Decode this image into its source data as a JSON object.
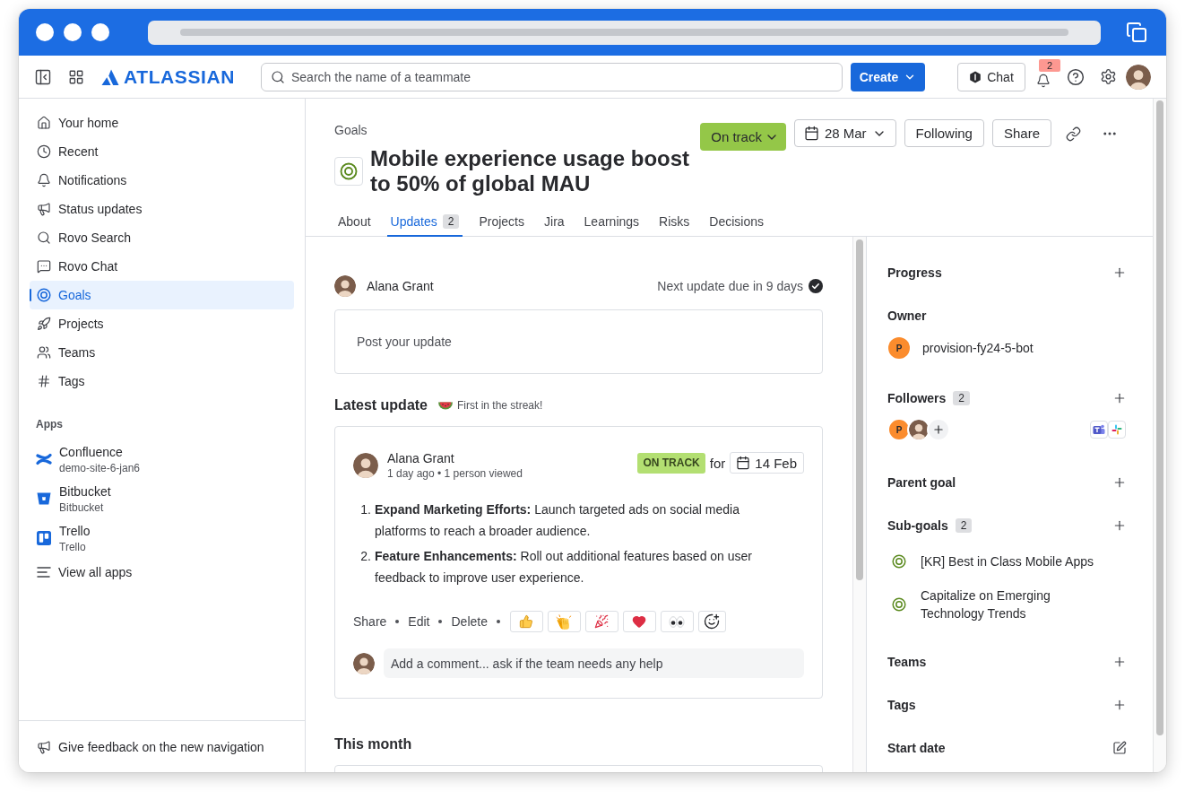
{
  "topbar": {
    "logo": "ATLASSIAN",
    "search": {
      "placeholder": "Search the name of a teammate"
    },
    "create_button": "Create",
    "chat_button": "Chat",
    "notification_count": "2"
  },
  "sidebar": {
    "items": [
      {
        "label": "Your home",
        "selected": false
      },
      {
        "label": "Recent",
        "selected": false
      },
      {
        "label": "Notifications",
        "selected": false
      },
      {
        "label": "Status updates",
        "selected": false
      },
      {
        "label": "Rovo Search",
        "selected": false
      },
      {
        "label": "Rovo Chat",
        "selected": false
      },
      {
        "label": "Goals",
        "selected": true
      },
      {
        "label": "Projects",
        "selected": false
      },
      {
        "label": "Teams",
        "selected": false
      },
      {
        "label": "Tags",
        "selected": false
      }
    ],
    "apps_heading": "Apps",
    "apps": [
      {
        "name": "Confluence",
        "subtitle": "demo-site-6-jan6"
      },
      {
        "name": "Bitbucket",
        "subtitle": "Bitbucket"
      },
      {
        "name": "Trello",
        "subtitle": "Trello"
      }
    ],
    "view_all_apps": "View all apps",
    "feedback": "Give feedback on the new navigation"
  },
  "header": {
    "breadcrumb": "Goals",
    "title": "Mobile experience usage boost to 50% of global MAU",
    "status_button": "On track",
    "date_button": "28 Mar",
    "following_button": "Following",
    "share_button": "Share"
  },
  "tabs": [
    {
      "label": "About",
      "selected": false
    },
    {
      "label": "Updates",
      "count": "2",
      "selected": true
    },
    {
      "label": "Projects",
      "selected": false
    },
    {
      "label": "Jira",
      "selected": false
    },
    {
      "label": "Learnings",
      "selected": false
    },
    {
      "label": "Risks",
      "selected": false
    },
    {
      "label": "Decisions",
      "selected": false
    }
  ],
  "updates": {
    "author": "Alana Grant",
    "next_update": "Next update due in 9 days",
    "post_field": {
      "placeholder": "Post your update"
    },
    "latest_heading": "Latest update",
    "streak": "First in the streak!",
    "latest": {
      "author": "Alana Grant",
      "meta": "1 day ago • 1 person viewed",
      "status": "ON TRACK",
      "for": "for",
      "date": "14 Feb",
      "items": [
        {
          "number": "1.",
          "text": "**Expand Marketing Efforts:** Launch targeted ads on social media platforms to reach a broader audience."
        },
        {
          "number": "2.",
          "text": "**Feature Enhancements:** Roll out additional features based on user feedback to improve user experience."
        }
      ],
      "actions": [
        "Share",
        "Edit",
        "Delete"
      ],
      "comment_field": {
        "placeholder": "Add a comment... ask if the team needs any help"
      }
    },
    "this_month_heading": "This month"
  },
  "details": {
    "sections": [
      {
        "kind": "add",
        "title": "Progress"
      },
      {
        "kind": "owner",
        "title": "Owner",
        "owner": {
          "initial": "P",
          "name": "provision-fy24-5-bot"
        }
      },
      {
        "kind": "followers",
        "title": "Followers",
        "count": "2",
        "followers": [
          {
            "kind": "initial",
            "initial": "P"
          },
          {
            "kind": "photo"
          }
        ]
      },
      {
        "kind": "add",
        "title": "Parent goal"
      },
      {
        "kind": "subgoals",
        "title": "Sub-goals",
        "count": "2",
        "goals": [
          "[KR] Best in Class Mobile Apps",
          "Capitalize on Emerging Technology Trends"
        ]
      },
      {
        "kind": "add",
        "title": "Teams"
      },
      {
        "kind": "add",
        "title": "Tags"
      },
      {
        "kind": "edit",
        "title": "Start date"
      }
    ]
  }
}
